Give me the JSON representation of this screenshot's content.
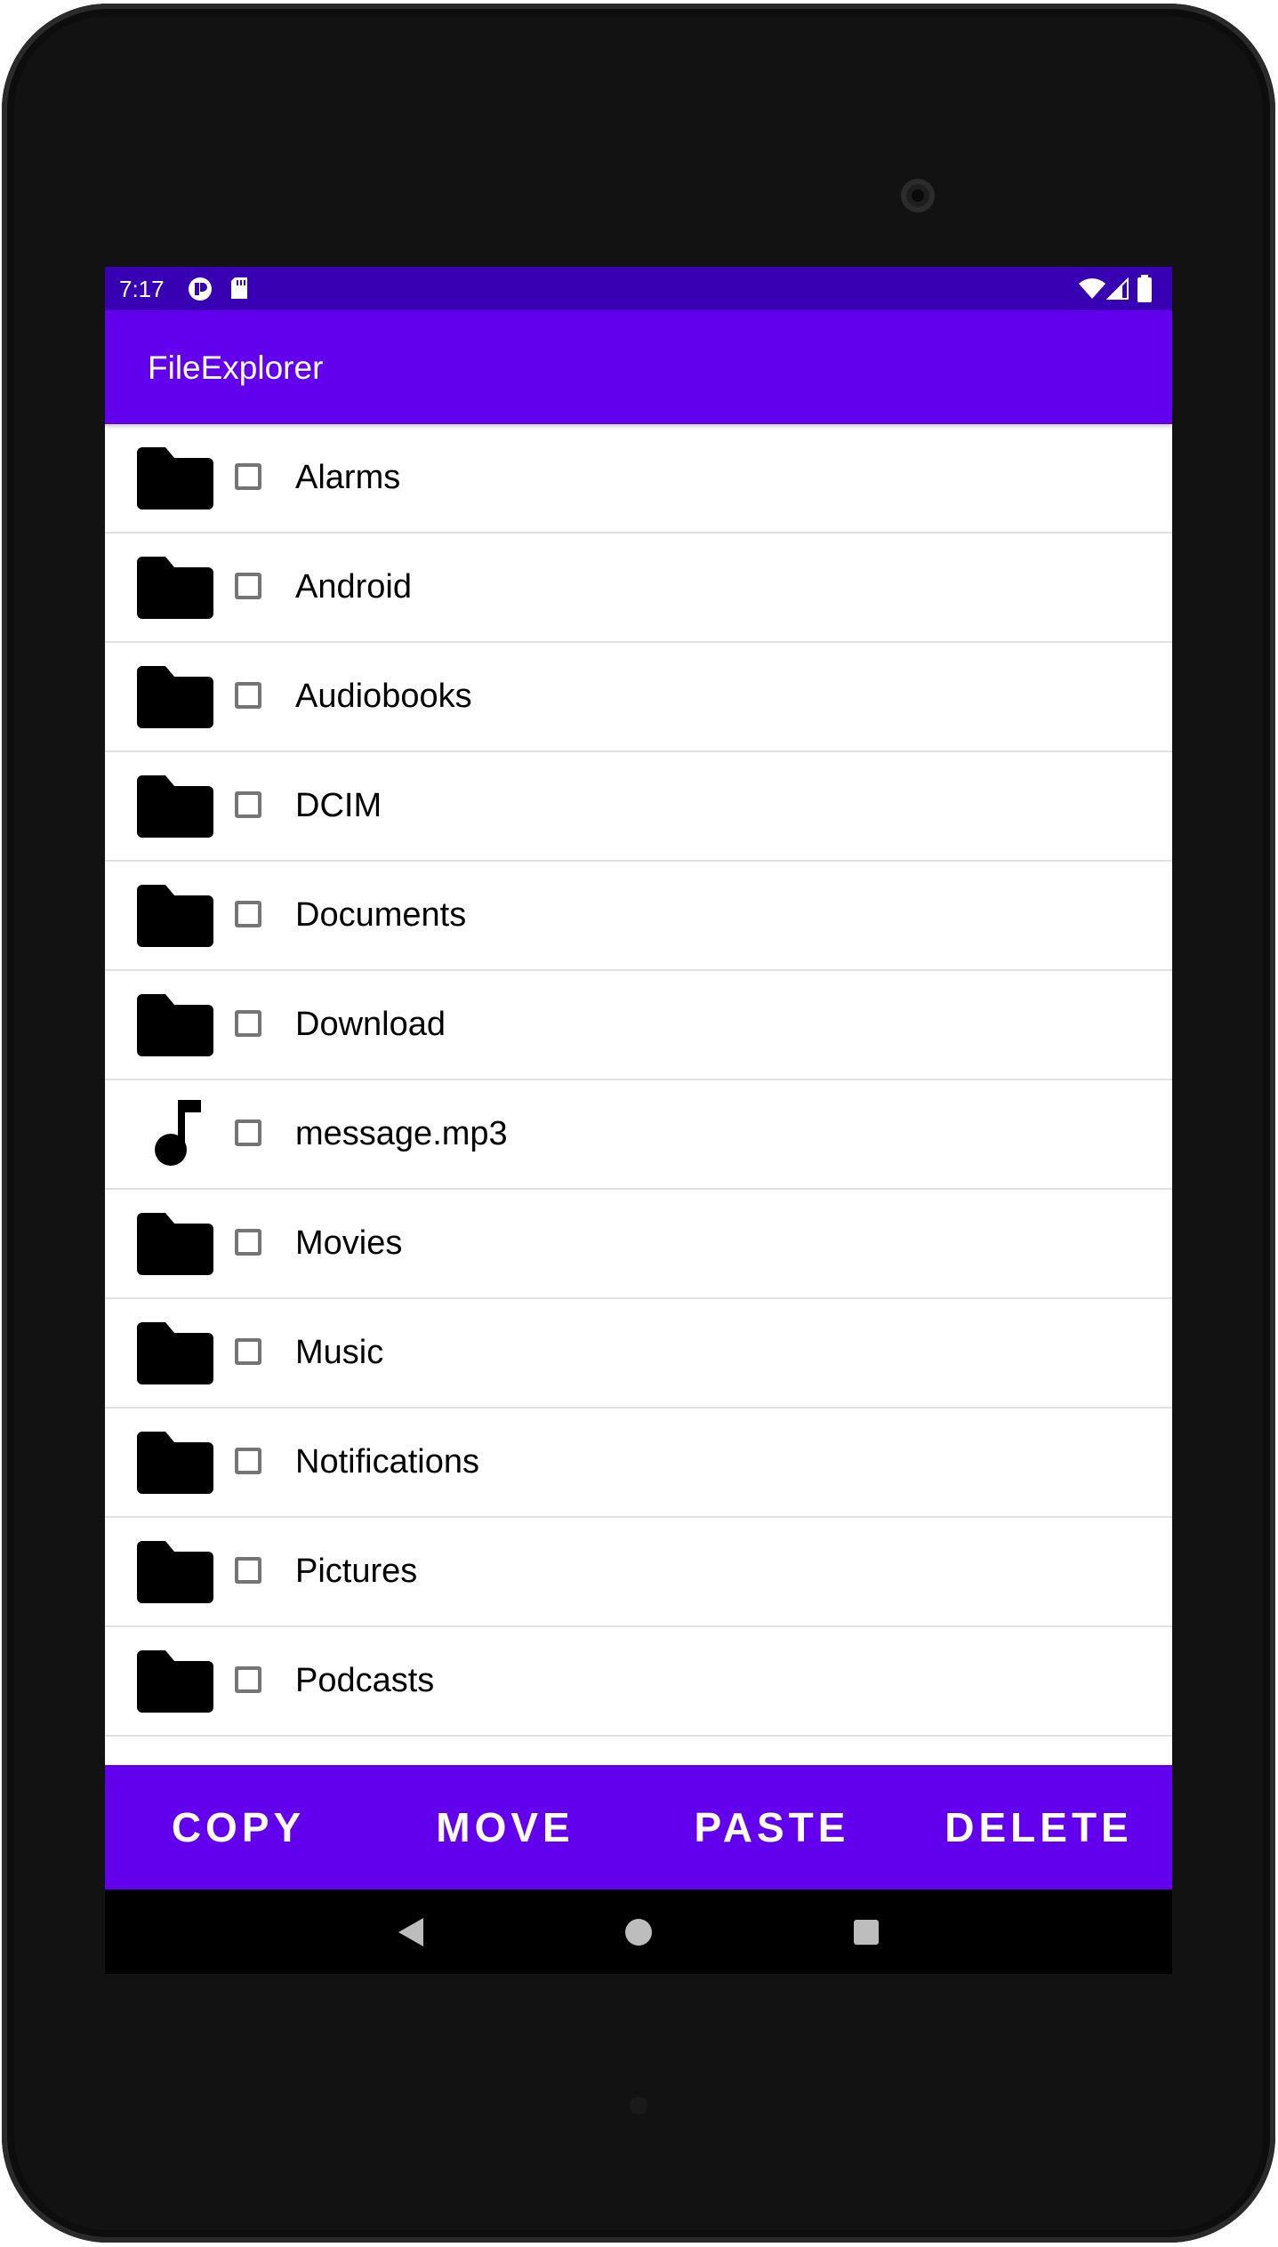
{
  "status_bar": {
    "time": "7:17",
    "background": "#3700b3",
    "left_icons": [
      "notification-app-icon",
      "sd-card-icon"
    ],
    "right_icons": [
      "wifi-icon",
      "cell-signal-icon",
      "battery-icon"
    ]
  },
  "app_bar": {
    "title": "FileExplorer",
    "background": "#6200ee"
  },
  "files": [
    {
      "name": "Alarms",
      "icon": "folder-icon",
      "checked": false
    },
    {
      "name": "Android",
      "icon": "folder-icon",
      "checked": false
    },
    {
      "name": "Audiobooks",
      "icon": "folder-icon",
      "checked": false
    },
    {
      "name": "DCIM",
      "icon": "folder-icon",
      "checked": false
    },
    {
      "name": "Documents",
      "icon": "folder-icon",
      "checked": false
    },
    {
      "name": "Download",
      "icon": "folder-icon",
      "checked": false
    },
    {
      "name": "message.mp3",
      "icon": "music-note-icon",
      "checked": false
    },
    {
      "name": "Movies",
      "icon": "folder-icon",
      "checked": false
    },
    {
      "name": "Music",
      "icon": "folder-icon",
      "checked": false
    },
    {
      "name": "Notifications",
      "icon": "folder-icon",
      "checked": false
    },
    {
      "name": "Pictures",
      "icon": "folder-icon",
      "checked": false
    },
    {
      "name": "Podcasts",
      "icon": "folder-icon",
      "checked": false
    }
  ],
  "actions": {
    "copy": "COPY",
    "move": "MOVE",
    "paste": "PASTE",
    "delete": "DELETE",
    "background": "#6200ee"
  },
  "nav_bar": {
    "buttons": [
      "back-icon",
      "home-icon",
      "recents-icon"
    ]
  }
}
